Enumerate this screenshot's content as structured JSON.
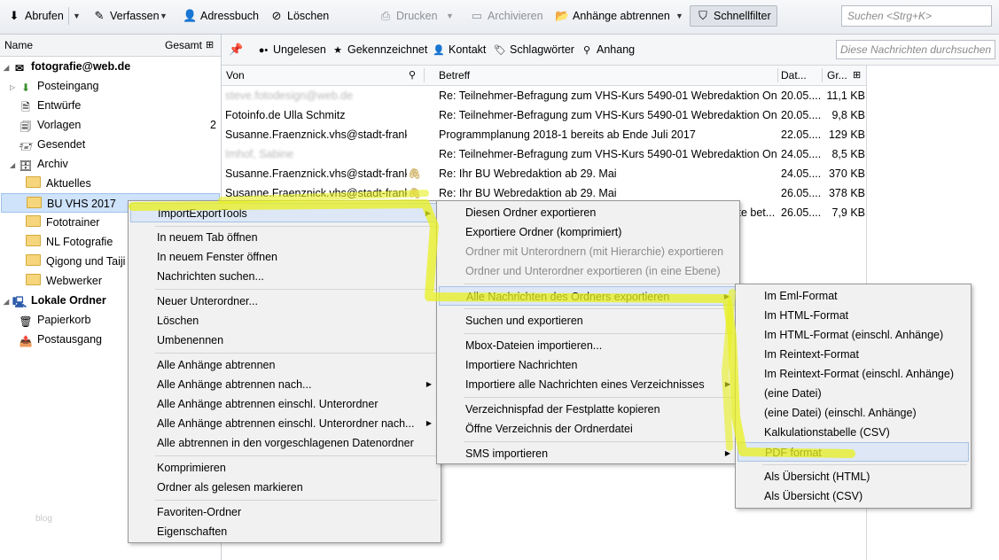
{
  "toolbar": {
    "get_messages": "Abrufen",
    "write": "Verfassen",
    "address_book": "Adressbuch",
    "delete": "Löschen",
    "print": "Drucken",
    "archive": "Archivieren",
    "detach": "Anhänge abtrennen",
    "quick_filter": "Schnellfilter",
    "search_placeholder": "Suchen <Strg+K>"
  },
  "folder_pane": {
    "col_name": "Name",
    "col_total": "Gesamt",
    "account": "fotografie@web.de",
    "folders": [
      {
        "label": "Posteingang",
        "count": ""
      },
      {
        "label": "Entwürfe",
        "count": ""
      },
      {
        "label": "Vorlagen",
        "count": "2"
      },
      {
        "label": "Gesendet",
        "count": ""
      },
      {
        "label": "Archiv",
        "count": ""
      },
      {
        "label": "Aktuelles",
        "count": ""
      },
      {
        "label": "BU VHS 2017",
        "count": ""
      },
      {
        "label": "Fototrainer",
        "count": ""
      },
      {
        "label": "NL Fotografie",
        "count": ""
      },
      {
        "label": "Qigong und Taiji",
        "count": ""
      },
      {
        "label": "Webwerker",
        "count": ""
      }
    ],
    "local_folders": "Lokale Ordner",
    "local": [
      "Papierkorb",
      "Postausgang"
    ],
    "watermark": "blog"
  },
  "filter_bar": {
    "unread": "Ungelesen",
    "starred": "Gekennzeichnet",
    "contact": "Kontakt",
    "tags": "Schlagwörter",
    "attachment": "Anhang",
    "search_placeholder": "Diese Nachrichten durchsuchen <"
  },
  "message_list": {
    "col_from": "Von",
    "col_subject": "Betreff",
    "col_date": "Dat...",
    "col_size": "Gr...",
    "rows": [
      {
        "from": "steve.fotodesign@web.de",
        "subject": "Re: Teilnehmer-Befragung zum VHS-Kurs 5490-01 Webredaktion Onlin...",
        "date": "20.05....",
        "size": "11,1 KB",
        "blur": true,
        "attach": false
      },
      {
        "from": "Fotoinfo.de Ulla Schmitz",
        "subject": "Re: Teilnehmer-Befragung zum VHS-Kurs 5490-01 Webredaktion Onlin...",
        "date": "20.05....",
        "size": "9,8 KB",
        "blur": false,
        "attach": false
      },
      {
        "from": "Susanne.Fraenznick.vhs@stadt-frank...",
        "subject": "Programmplanung 2018-1 bereits ab Ende Juli 2017",
        "date": "22.05....",
        "size": "129 KB",
        "blur": false,
        "attach": false
      },
      {
        "from": "Imhof, Sabine",
        "subject": "Re: Teilnehmer-Befragung zum VHS-Kurs 5490-01 Webredaktion Onlin...",
        "date": "24.05....",
        "size": "8,5 KB",
        "blur": true,
        "attach": false
      },
      {
        "from": "Susanne.Fraenznick.vhs@stadt-frank...",
        "subject": "Re: Ihr BU Webredaktion ab 29. Mai",
        "date": "24.05....",
        "size": "370 KB",
        "blur": false,
        "attach": true
      },
      {
        "from": "Susanne.Fraenznick.vhs@stadt-frank...",
        "subject": "Re: Ihr BU Webredaktion ab 29. Mai",
        "date": "26.05....",
        "size": "378 KB",
        "blur": false,
        "attach": true
      },
      {
        "from": "",
        "subject": "tte bet...",
        "date": "26.05....",
        "size": "7,9 KB",
        "blur": false,
        "attach": false
      }
    ]
  },
  "context_menu": [
    "ImportExportTools",
    "In neuem Tab öffnen",
    "In neuem Fenster öffnen",
    "Nachrichten suchen...",
    "Neuer Unterordner...",
    "Löschen",
    "Umbenennen",
    "Alle Anhänge abtrennen",
    "Alle Anhänge abtrennen nach...",
    "Alle Anhänge abtrennen einschl. Unterordner",
    "Alle Anhänge abtrennen einschl. Unterordner nach...",
    "Alle abtrennen in den vorgeschlagenen Datenordner",
    "Komprimieren",
    "Ordner als gelesen markieren",
    "Favoriten-Ordner",
    "Eigenschaften"
  ],
  "submenu_1": [
    "Diesen Ordner exportieren",
    "Exportiere Ordner (komprimiert)",
    "Ordner mit Unterordnern (mit Hierarchie) exportieren",
    "Ordner und Unterordner exportieren (in eine Ebene)",
    "Alle Nachrichten des Ordners exportieren",
    "Suchen und exportieren",
    "Mbox-Dateien importieren...",
    "Importiere Nachrichten",
    "Importiere alle Nachrichten eines Verzeichnisses",
    "Verzeichnispfad der Festplatte kopieren",
    "Öffne Verzeichnis der Ordnerdatei",
    "SMS importieren"
  ],
  "submenu_2": [
    "Im Eml-Format",
    "Im HTML-Format",
    "Im HTML-Format (einschl. Anhänge)",
    "Im Reintext-Format",
    "Im Reintext-Format (einschl. Anhänge)",
    "(eine Datei)",
    "(eine Datei) (einschl. Anhänge)",
    "Kalkulationstabelle (CSV)",
    "PDF format",
    "Als Übersicht (HTML)",
    "Als Übersicht (CSV)"
  ],
  "colors": {
    "highlighter": "#e8f01e",
    "selection": "#cfe3fb",
    "menu_bg": "#f1f1f1"
  }
}
